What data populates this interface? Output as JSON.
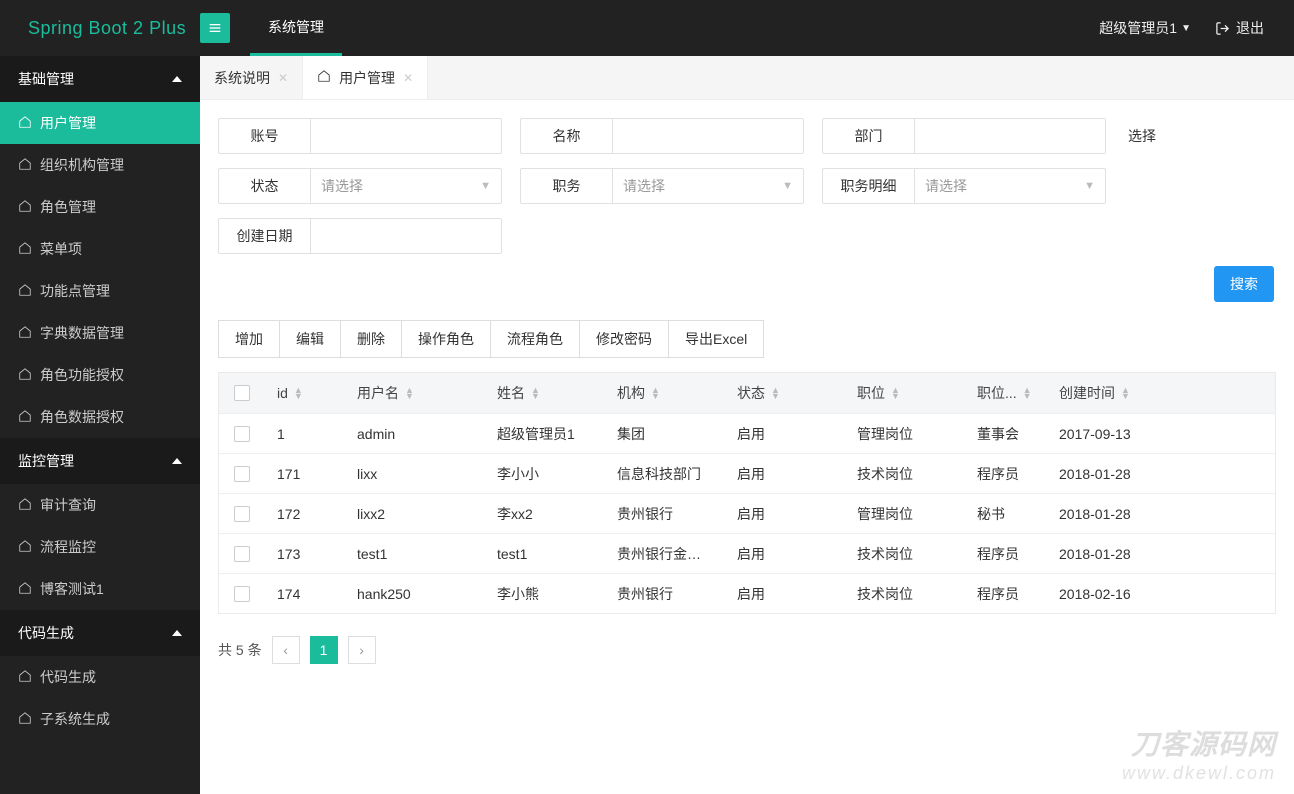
{
  "brand": "Spring Boot 2 Plus",
  "header": {
    "activeTopTab": "系统管理",
    "user": "超级管理员1",
    "logoutLabel": "退出"
  },
  "sidebar": {
    "groups": [
      {
        "title": "基础管理",
        "items": [
          "用户管理",
          "组织机构管理",
          "角色管理",
          "菜单项",
          "功能点管理",
          "字典数据管理",
          "角色功能授权",
          "角色数据授权"
        ],
        "activeIndex": 0
      },
      {
        "title": "监控管理",
        "items": [
          "审计查询",
          "流程监控",
          "博客测试1"
        ]
      },
      {
        "title": "代码生成",
        "items": [
          "代码生成",
          "子系统生成"
        ]
      }
    ]
  },
  "tabs": [
    {
      "label": "系统说明",
      "active": false,
      "icon": false
    },
    {
      "label": "用户管理",
      "active": true,
      "icon": true
    }
  ],
  "filters": {
    "account": {
      "label": "账号",
      "value": ""
    },
    "name": {
      "label": "名称",
      "value": ""
    },
    "dept": {
      "label": "部门",
      "value": "",
      "extra": "选择"
    },
    "state": {
      "label": "状态",
      "placeholder": "请选择"
    },
    "position": {
      "label": "职务",
      "placeholder": "请选择"
    },
    "posDetail": {
      "label": "职务明细",
      "placeholder": "请选择"
    },
    "createDate": {
      "label": "创建日期",
      "value": ""
    }
  },
  "searchBtn": "搜索",
  "toolbar": [
    "增加",
    "编辑",
    "删除",
    "操作角色",
    "流程角色",
    "修改密码",
    "导出Excel"
  ],
  "columns": [
    "",
    "id",
    "用户名",
    "姓名",
    "机构",
    "状态",
    "职位",
    "职位...",
    "创建时间"
  ],
  "rows": [
    {
      "id": "1",
      "user": "admin",
      "name": "超级管理员1",
      "org": "集团",
      "state": "启用",
      "pos": "管理岗位",
      "posd": "董事会",
      "date": "2017-09-13"
    },
    {
      "id": "171",
      "user": "lixx",
      "name": "李小小",
      "org": "信息科技部门",
      "state": "启用",
      "pos": "技术岗位",
      "posd": "程序员",
      "date": "2018-01-28"
    },
    {
      "id": "172",
      "user": "lixx2",
      "name": "李xx2",
      "org": "贵州银行",
      "state": "启用",
      "pos": "管理岗位",
      "posd": "秘书",
      "date": "2018-01-28"
    },
    {
      "id": "173",
      "user": "test1",
      "name": "test1",
      "org": "贵州银行金…",
      "state": "启用",
      "pos": "技术岗位",
      "posd": "程序员",
      "date": "2018-01-28"
    },
    {
      "id": "174",
      "user": "hank250",
      "name": "李小熊",
      "org": "贵州银行",
      "state": "启用",
      "pos": "技术岗位",
      "posd": "程序员",
      "date": "2018-02-16"
    }
  ],
  "pager": {
    "total": "共 5 条",
    "current": "1"
  },
  "watermark": {
    "l1": "刀客源码网",
    "l2": "www.dkewl.com"
  }
}
